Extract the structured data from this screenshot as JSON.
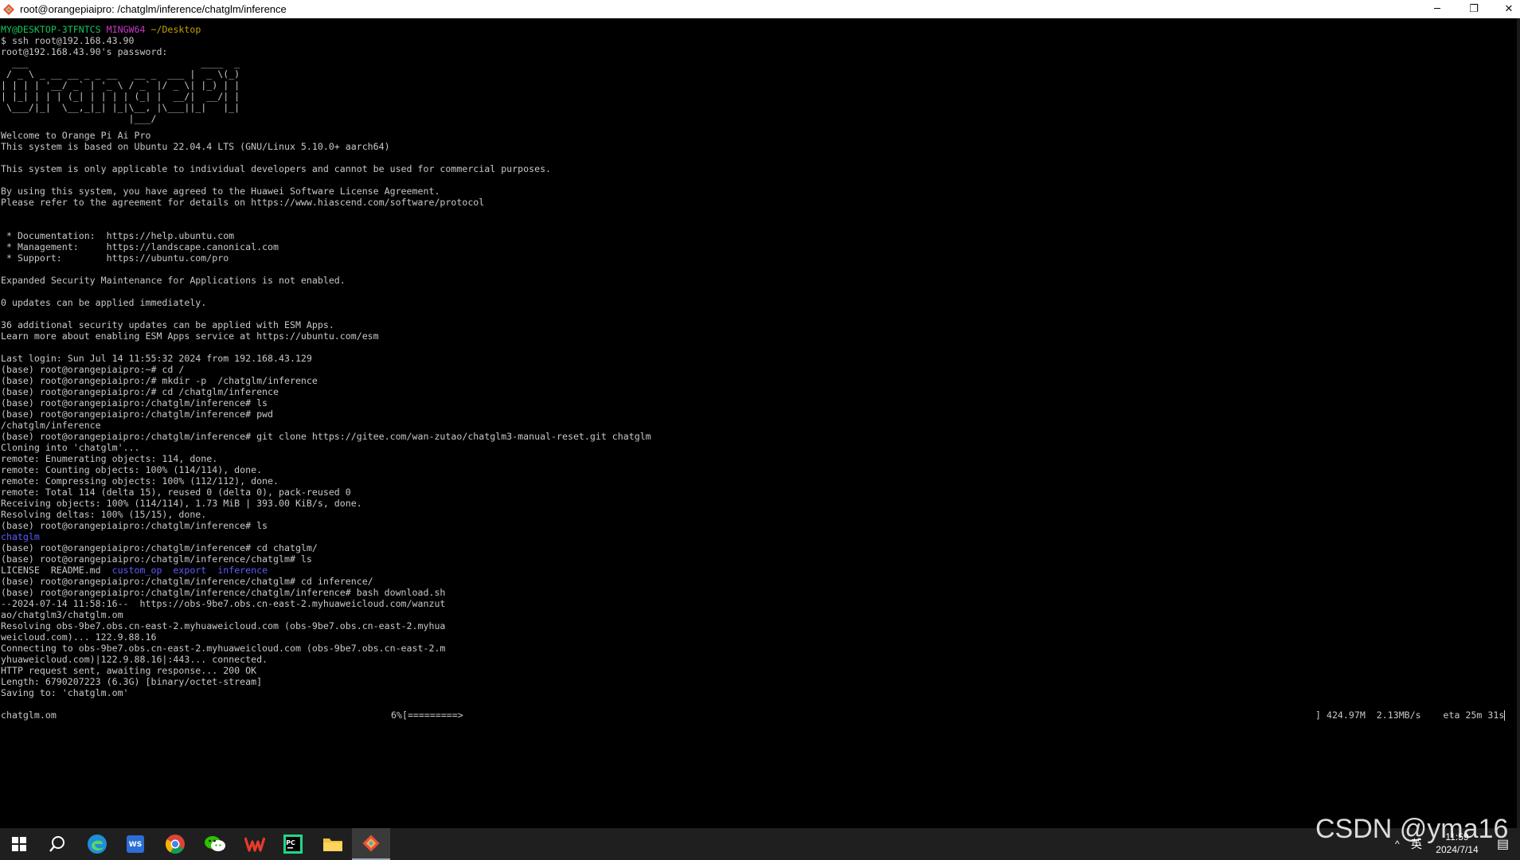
{
  "window": {
    "title": "root@orangepiaipro: /chatglm/inference/chatglm/inference",
    "minimize_glyph": "─",
    "restore_glyph": "❐",
    "close_glyph": "✕"
  },
  "prompt": {
    "user_host": "MY@DESKTOP-3TFNTCS",
    "shell": "MINGW64",
    "path": "~/Desktop",
    "first_cmd": "$ ssh root@192.168.43.90"
  },
  "lines": {
    "l02": "root@192.168.43.90's password:",
    "banner1": "  ___                               ____  _ ",
    "banner2": " / _ \\ _ __ __ _ _ __   __ _  ___ |  _ \\(_)",
    "banner3": "| | | | '__/ _` | '_ \\ / _` |/ _ \\| |_) | |",
    "banner4": "| |_| | | | (_| | | | | (_| |  __/|  __/| |",
    "banner5": " \\___/|_|  \\__,_|_| |_|\\__, |\\___||_|   |_|",
    "banner6": "                       |___/              ",
    "l09": "Welcome to Orange Pi Ai Pro",
    "l10": "This system is based on Ubuntu 22.04.4 LTS (GNU/Linux 5.10.0+ aarch64)",
    "l12": "This system is only applicable to individual developers and cannot be used for commercial purposes.",
    "l14": "By using this system, you have agreed to the Huawei Software License Agreement.",
    "l15": "Please refer to the agreement for details on https://www.hiascend.com/software/protocol",
    "l19": " * Documentation:  https://help.ubuntu.com",
    "l20": " * Management:     https://landscape.canonical.com",
    "l21": " * Support:        https://ubuntu.com/pro",
    "l23": "Expanded Security Maintenance for Applications is not enabled.",
    "l25": "0 updates can be applied immediately.",
    "l27": "36 additional security updates can be applied with ESM Apps.",
    "l28": "Learn more about enabling ESM Apps service at https://ubuntu.com/esm",
    "l30": "Last login: Sun Jul 14 11:55:32 2024 from 192.168.43.129",
    "l31": "(base) root@orangepiaipro:~# cd /",
    "l32": "(base) root@orangepiaipro:/# mkdir -p  /chatglm/inference",
    "l33": "(base) root@orangepiaipro:/# cd /chatglm/inference",
    "l34": "(base) root@orangepiaipro:/chatglm/inference# ls",
    "l35": "(base) root@orangepiaipro:/chatglm/inference# pwd",
    "l36": "/chatglm/inference",
    "l37": "(base) root@orangepiaipro:/chatglm/inference# git clone https://gitee.com/wan-zutao/chatglm3-manual-reset.git chatglm",
    "l38": "Cloning into 'chatglm'...",
    "l39": "remote: Enumerating objects: 114, done.",
    "l40": "remote: Counting objects: 100% (114/114), done.",
    "l41": "remote: Compressing objects: 100% (112/112), done.",
    "l42": "remote: Total 114 (delta 15), reused 0 (delta 0), pack-reused 0",
    "l43": "Receiving objects: 100% (114/114), 1.73 MiB | 393.00 KiB/s, done.",
    "l44": "Resolving deltas: 100% (15/15), done.",
    "l45": "(base) root@orangepiaipro:/chatglm/inference# ls",
    "l46": "chatglm",
    "l47": "(base) root@orangepiaipro:/chatglm/inference# cd chatglm/",
    "l48": "(base) root@orangepiaipro:/chatglm/inference/chatglm# ls",
    "l49_a": "LICENSE  README.md  ",
    "l49_b": "custom_op",
    "l49_c": "export",
    "l49_d": "inference",
    "l50": "(base) root@orangepiaipro:/chatglm/inference/chatglm# cd inference/",
    "l51": "(base) root@orangepiaipro:/chatglm/inference/chatglm/inference# bash download.sh",
    "l52": "--2024-07-14 11:58:16--  https://obs-9be7.obs.cn-east-2.myhuaweicloud.com/wanzut",
    "l53": "ao/chatglm3/chatglm.om",
    "l54": "Resolving obs-9be7.obs.cn-east-2.myhuaweicloud.com (obs-9be7.obs.cn-east-2.myhua",
    "l55": "weicloud.com)... 122.9.88.16",
    "l56": "Connecting to obs-9be7.obs.cn-east-2.myhuaweicloud.com (obs-9be7.obs.cn-east-2.m",
    "l57": "yhuaweicloud.com)|122.9.88.16|:443... connected.",
    "l58": "HTTP request sent, awaiting response... 200 OK",
    "l59": "Length: 6790207223 (6.3G) [binary/octet-stream]",
    "l60": "Saving to: 'chatglm.om'"
  },
  "download": {
    "filename": "chatglm.om",
    "progress": "6%[=========>",
    "stats": "] 424.97M  2.13MB/s    eta 25m 31s"
  },
  "taskbar": {
    "apps": [
      "start",
      "search",
      "edge",
      "wps-writer",
      "chrome",
      "wechat",
      "wps",
      "pycharm",
      "file-explorer",
      "git-bash"
    ],
    "tray_chevron": "^",
    "ime": "英",
    "time": "11:59",
    "date": "2024/7/14",
    "notification_glyph": "▤"
  },
  "watermark": "CSDN @yma16",
  "colors": {
    "prompt_green": "#13c45a",
    "prompt_purple": "#c43ac4",
    "prompt_yellow": "#c4a000",
    "dir_blue": "#5c5cff",
    "text": "#c8c8c8"
  }
}
